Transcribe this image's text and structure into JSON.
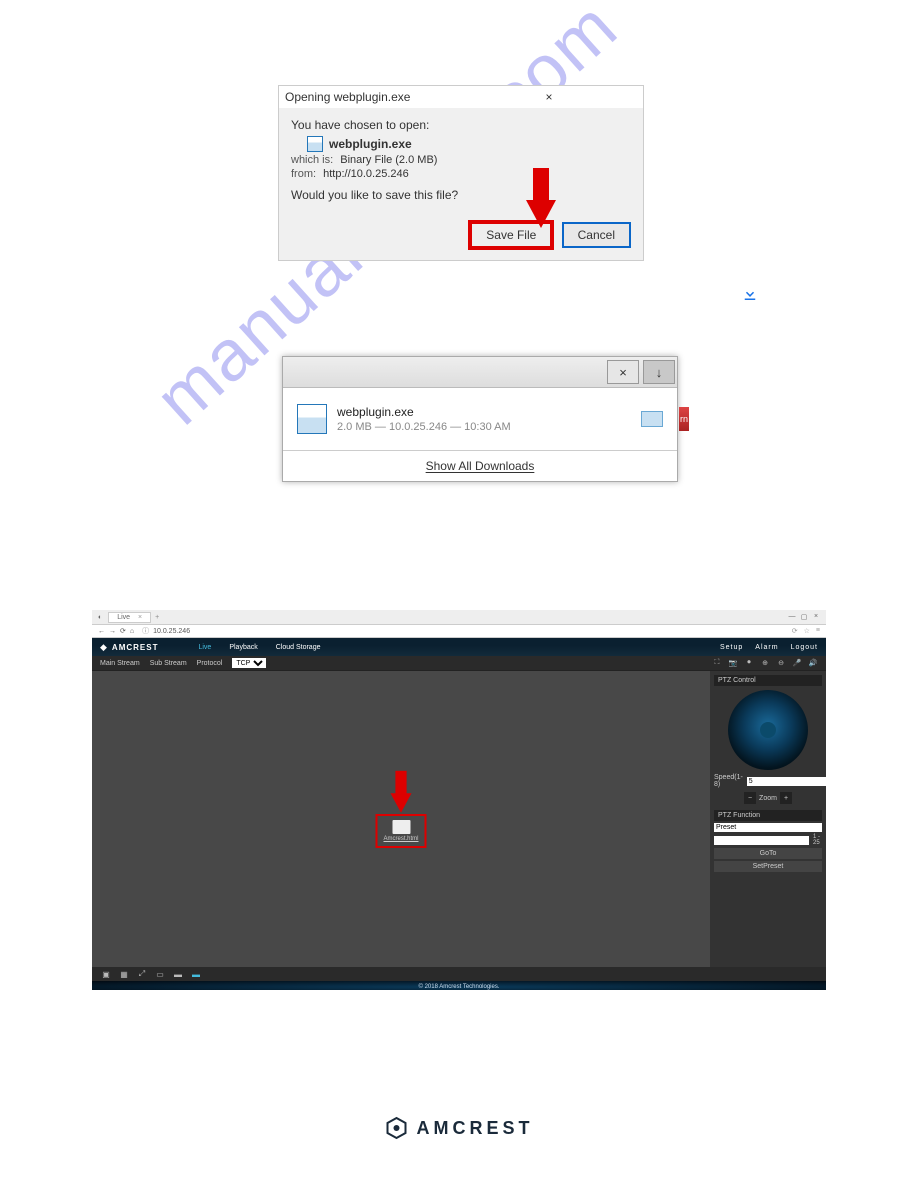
{
  "dialog1": {
    "title": "Opening webplugin.exe",
    "close": "×",
    "chosen": "You have chosen to open:",
    "filename": "webplugin.exe",
    "which_is_lbl": "which is:",
    "which_is_val": "Binary File (2.0 MB)",
    "from_lbl": "from:",
    "from_val": "http://10.0.25.246",
    "save_q": "Would you like to save this file?",
    "save_btn": "Save File",
    "cancel_btn": "Cancel"
  },
  "download_panel": {
    "close_btn": "×",
    "dl_btn": "↓",
    "filename": "webplugin.exe",
    "meta": "2.0 MB — 10.0.25.246 — 10:30 AM",
    "show_all": "Show All Downloads",
    "edge_label": "rn"
  },
  "amcrest": {
    "tab_title": "Live",
    "tab_close": "×",
    "tab_add": "+",
    "url": "10.0.25.246",
    "nav_back": "←",
    "nav_fwd": "→",
    "nav_reload": "⟳",
    "nav_home": "⌂",
    "win_min": "—",
    "win_max": "▢",
    "win_close": "×",
    "brand": "AMCREST",
    "nav": {
      "live": "Live",
      "playback": "Playback",
      "cloud": "Cloud Storage"
    },
    "top_right": {
      "setup": "Setup",
      "alarm": "Alarm",
      "logout": "Logout"
    },
    "sub": {
      "main": "Main Stream",
      "sub": "Sub Stream",
      "protocol": "Protocol",
      "protocol_val": "TCP"
    },
    "plugin_link": "Amcrest.html",
    "ptz": {
      "title": "PTZ Control",
      "speed_lbl": "Speed(1-8)",
      "speed_val": "5",
      "zoom": "Zoom",
      "minus": "−",
      "plus": "+",
      "func_title": "PTZ Function",
      "preset_lbl": "Preset",
      "preset_val": "Preset",
      "range": "1 - 25",
      "goto": "GoTo",
      "setpreset": "SetPreset"
    },
    "copyright": "© 2018 Amcrest Technologies."
  },
  "watermark": "manualshive.com",
  "footer_brand": "AMCREST"
}
